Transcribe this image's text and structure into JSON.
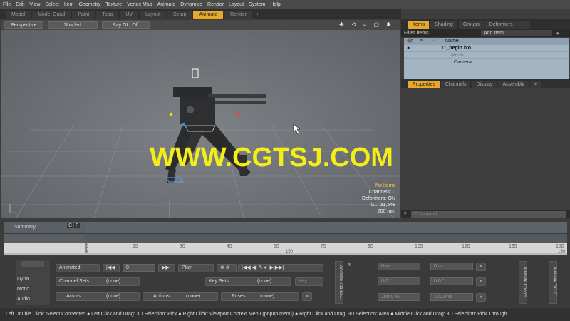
{
  "menu": [
    "File",
    "Edit",
    "View",
    "Select",
    "Item",
    "Geometry",
    "Texture",
    "Vertex Map",
    "Animate",
    "Dynamics",
    "Render",
    "Layout",
    "System",
    "Help"
  ],
  "layout_tabs": [
    "Model",
    "Model Quad",
    "Paint",
    "Topo",
    "UV",
    "Layout",
    "Setup",
    "Animate",
    "Render",
    "+"
  ],
  "active_layout_tab": "Animate",
  "viewport": {
    "view_label": "Perspective",
    "shading_label": "Shaded",
    "raygl_label": "Ray GL: Off",
    "info": {
      "no_items": "No Items",
      "channels": "Channels: 0",
      "deformers": "Deformers: ON",
      "gl": "GL: 31,548",
      "size": "200 mm"
    }
  },
  "watermark": "WWW.CGTSJ.COM",
  "items_panel": {
    "tabs": [
      "Items",
      "Shading",
      "Groups",
      "Deformers",
      "+"
    ],
    "active_tab": "Items",
    "filter_label": "Filter Items",
    "add_item_label": "Add Item",
    "column_name": "Name",
    "rows": [
      {
        "name": "11_begin.lxo"
      },
      {
        "name": "Mesh"
      },
      {
        "name": "Camera"
      }
    ]
  },
  "properties_panel": {
    "tabs": [
      "Properties",
      "Channels",
      "Display",
      "Assembly",
      "+"
    ],
    "active_tab": "Properties",
    "command_placeholder": "Command"
  },
  "timeline": {
    "summary_label": "Summary",
    "ticks": [
      "0",
      "15",
      "30",
      "45",
      "60",
      "75",
      "90",
      "105",
      "120",
      "135",
      "150"
    ],
    "sub_ticks": [
      "0",
      "150",
      "150"
    ]
  },
  "controls": {
    "side_buttons": [
      "Dyna",
      "Motio",
      "Audio"
    ],
    "animated_label": "Animated",
    "frame_value": "0",
    "play_label": "Play",
    "channel_sets_label": "Channel Sets",
    "none": "(none)",
    "key_sets_label": "Key Sets",
    "key_label": "Key",
    "actors_label": "Actors",
    "actions_label": "Actions",
    "poses_label": "Poses",
    "vtab_left": "Animate 701 Ke...",
    "vtab_mid": "Animate Coords",
    "vtab_right": "Animate 701 C...",
    "pos_x": "0 m",
    "pos_y": "0 m",
    "rot_x": "0.0 °",
    "rot_y": "0.0 °",
    "scl_x": "100.0 %",
    "scl_y": "100.0 %"
  },
  "status": "Left Double Click: Select Connected ● Left Click and Drag: 3D Selection: Pick ● Right Click: Viewport Context Menu (popup menu) ● Right Click and Drag: 3D Selection: Area ● Middle Click and Drag: 3D Selection: Pick Through"
}
